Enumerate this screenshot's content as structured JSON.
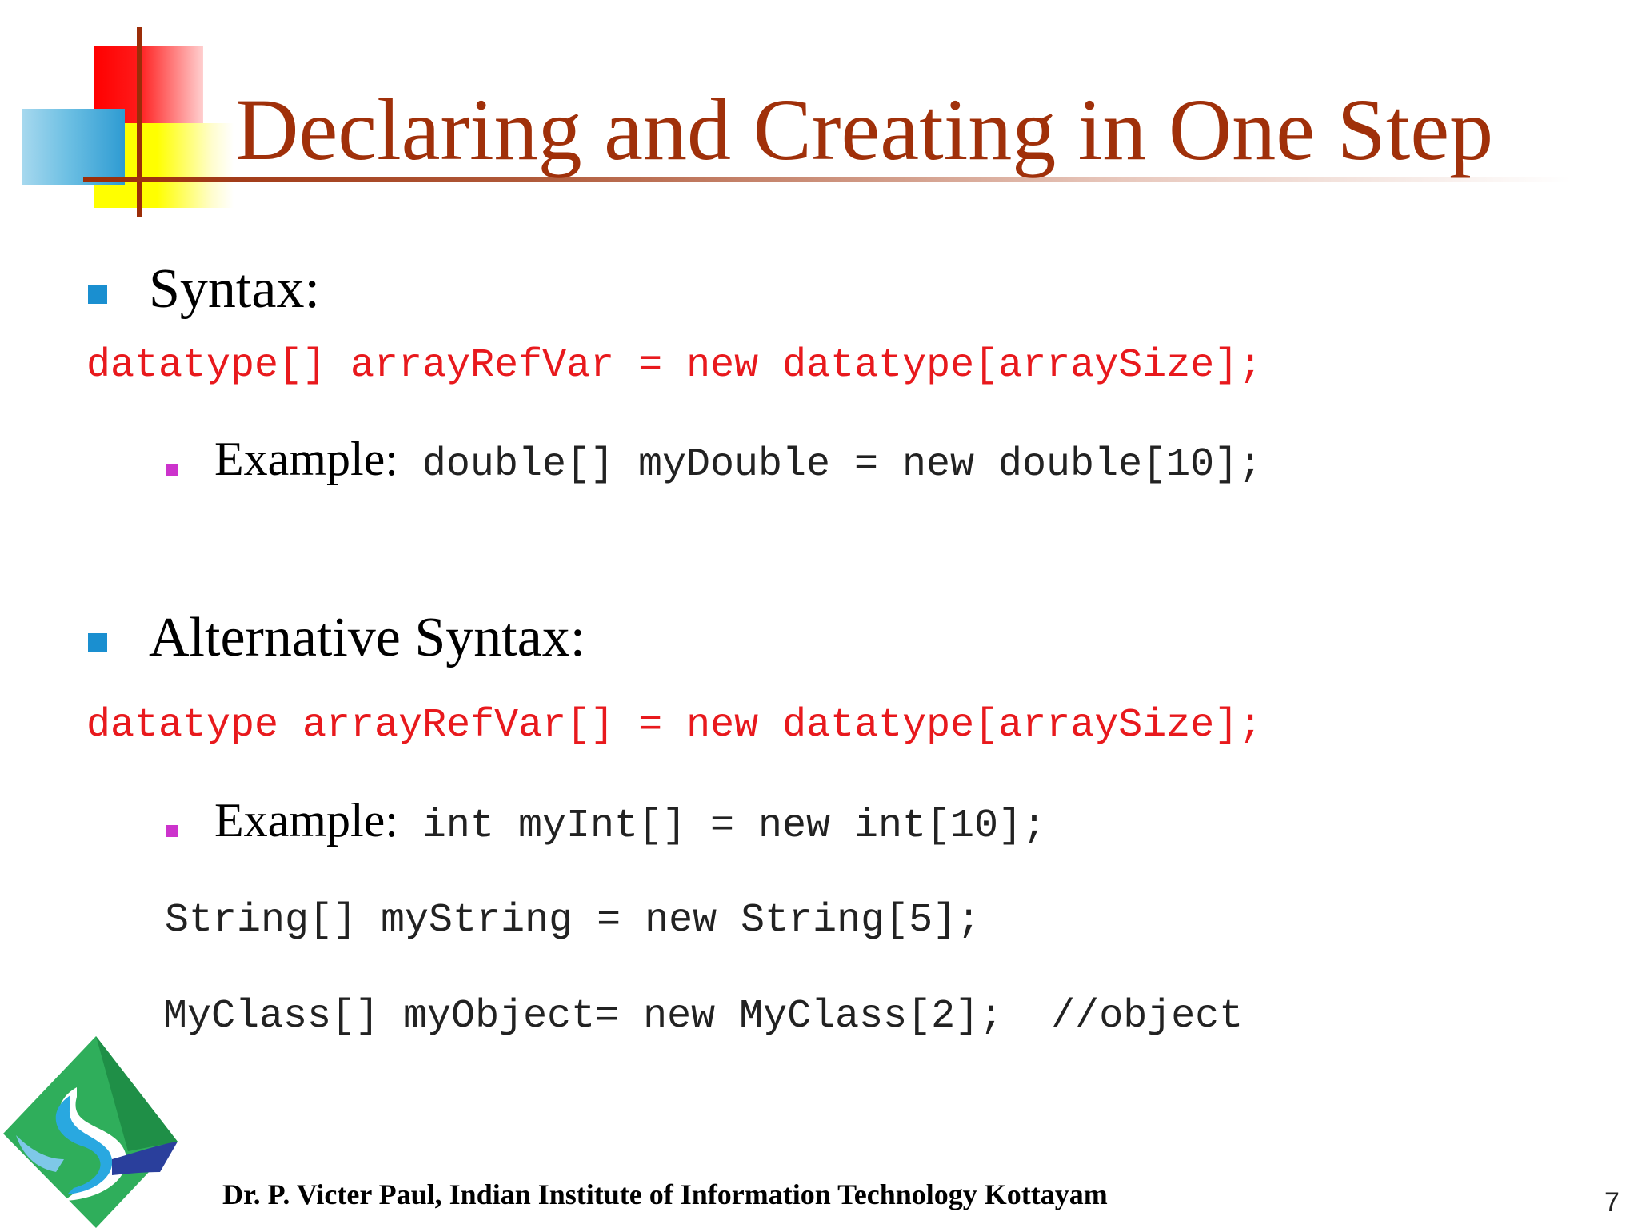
{
  "slide": {
    "title": "Declaring and Creating in One Step",
    "page_number": "7",
    "footer": "Dr. P. Victer Paul, Indian Institute of Information Technology Kottayam",
    "logo_icon": "iiit-kottayam-logo-icon",
    "colors": {
      "title": "#a0300a",
      "code_highlight": "#e8191d",
      "bullet_main": "#1a8fd0",
      "bullet_sub": "#cc33cc"
    }
  },
  "sections": [
    {
      "heading": "Syntax:",
      "syntax_code": "datatype[] arrayRefVar = new datatype[arraySize];",
      "example_label": "Example:",
      "example_code": " double[] myDouble = new double[10];"
    },
    {
      "heading": "Alternative Syntax:",
      "syntax_code": "datatype arrayRefVar[] = new datatype[arraySize];",
      "example_label": "Example:",
      "example_code": " int myInt[] = new int[10];",
      "extra_lines": [
        "String[] myString = new String[5];",
        "MyClass[] myObject= new MyClass[2];  //object"
      ]
    }
  ]
}
